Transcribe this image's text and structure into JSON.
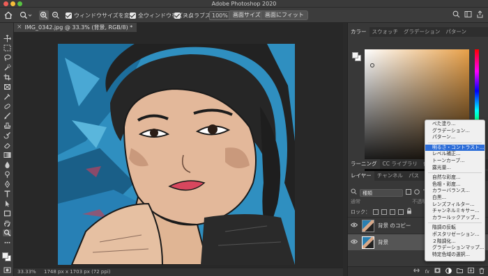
{
  "app": {
    "title": "Adobe Photoshop 2020"
  },
  "options_bar": {
    "checkboxes": [
      {
        "label": "ウィンドウサイズを変更",
        "checked": true
      },
      {
        "label": "全ウィンドウをズーム",
        "checked": false
      },
      {
        "label": "スクラブズーム",
        "checked": true
      }
    ],
    "zoom_value": "100%",
    "fit_screen_label": "画面サイズ",
    "fill_screen_label": "画面にフィット"
  },
  "document": {
    "tab_title": "IMG_0342.jpg @ 33.3% (背景, RGB/8) *",
    "close_glyph": "×",
    "status_zoom": "33.33%",
    "status_info": "1748 px x 1703 px (72 ppi)"
  },
  "color_panel": {
    "tabs": [
      "カラー",
      "スウォッチ",
      "グラデーション",
      "パターン"
    ],
    "accent_color": "#e8a048"
  },
  "layers_panel": {
    "tabs": [
      "ラーニング",
      "CC ライブラリ",
      "色調"
    ],
    "sub_tabs": [
      "レイヤー",
      "チャンネル",
      "パス"
    ],
    "kind_label": "種類",
    "blend_mode": "通常",
    "opacity_label": "不透明",
    "lock_label": "ロック：",
    "layers": [
      {
        "name": "背景 のコピー",
        "selected": false
      },
      {
        "name": "背景",
        "selected": true
      }
    ]
  },
  "adjustment_menu": {
    "highlighted_index": 3,
    "groups": [
      [
        "べた塗り...",
        "グラデーション...",
        "パターン..."
      ],
      [
        "明るさ・コントラスト...",
        "レベル補正...",
        "トーンカーブ...",
        "露光量..."
      ],
      [
        "自然な彩度...",
        "色相・彩度...",
        "カラーバランス...",
        "白黒...",
        "レンズフィルター...",
        "チャンネルミキサー...",
        "カラールックアップ..."
      ],
      [
        "階調の反転",
        "ポスタリゼーション...",
        "２階調化...",
        "グラデーションマップ...",
        "特定色域の選択..."
      ]
    ]
  }
}
